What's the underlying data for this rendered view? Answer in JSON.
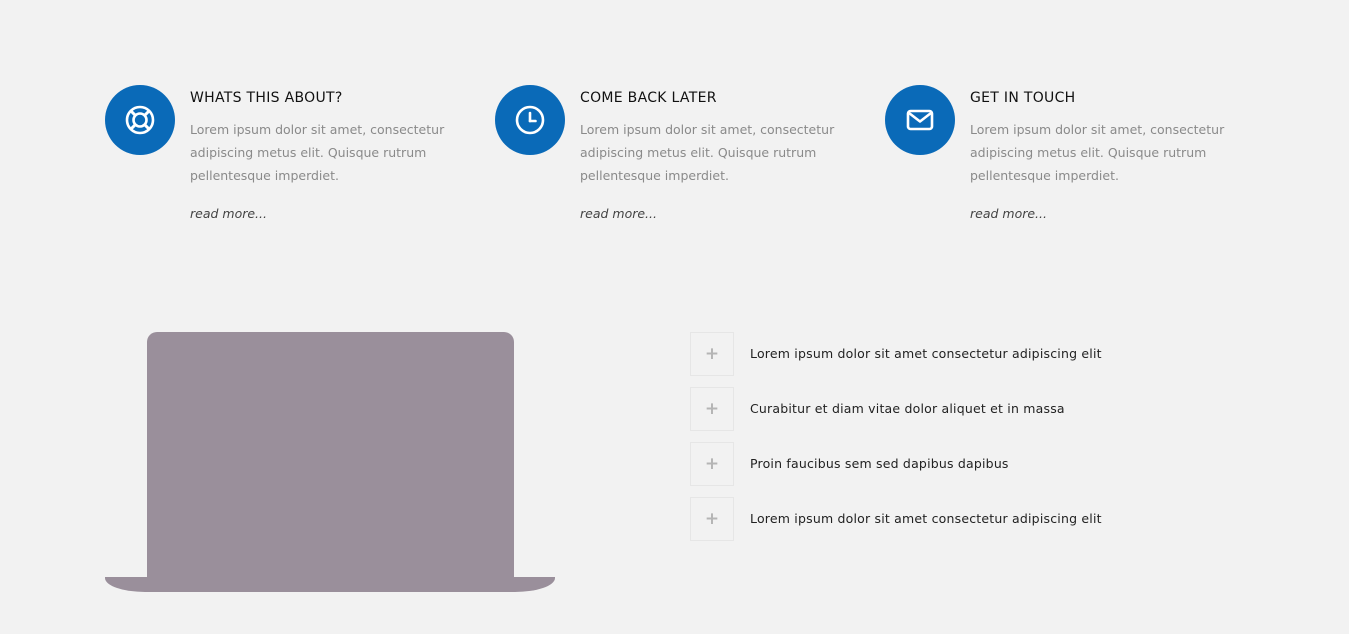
{
  "features": [
    {
      "icon": "lifebuoy-icon",
      "title": "WHATS THIS ABOUT?",
      "text": "Lorem ipsum dolor sit amet, consectetur adipiscing metus elit. Quisque rutrum pellentesque imperdiet.",
      "link": "read more..."
    },
    {
      "icon": "clock-icon",
      "title": "COME BACK LATER",
      "text": "Lorem ipsum dolor sit amet, consectetur adipiscing metus elit. Quisque rutrum pellentesque imperdiet.",
      "link": "read more..."
    },
    {
      "icon": "envelope-icon",
      "title": "GET IN TOUCH",
      "text": "Lorem ipsum dolor sit amet, consectetur adipiscing metus elit. Quisque rutrum pellentesque imperdiet.",
      "link": "read more..."
    }
  ],
  "accordion": {
    "toggle_symbol": "+",
    "items": [
      {
        "label": "Lorem ipsum dolor sit amet consectetur adipiscing elit"
      },
      {
        "label": "Curabitur et diam vitae dolor aliquet et in massa"
      },
      {
        "label": "Proin faucibus sem sed dapibus dapibus"
      },
      {
        "label": "Lorem ipsum dolor sit amet consectetur adipiscing elit"
      }
    ]
  },
  "colors": {
    "background": "#f2f2f2",
    "accent": "#0a6ab8",
    "laptop": "#9a8f9b"
  }
}
